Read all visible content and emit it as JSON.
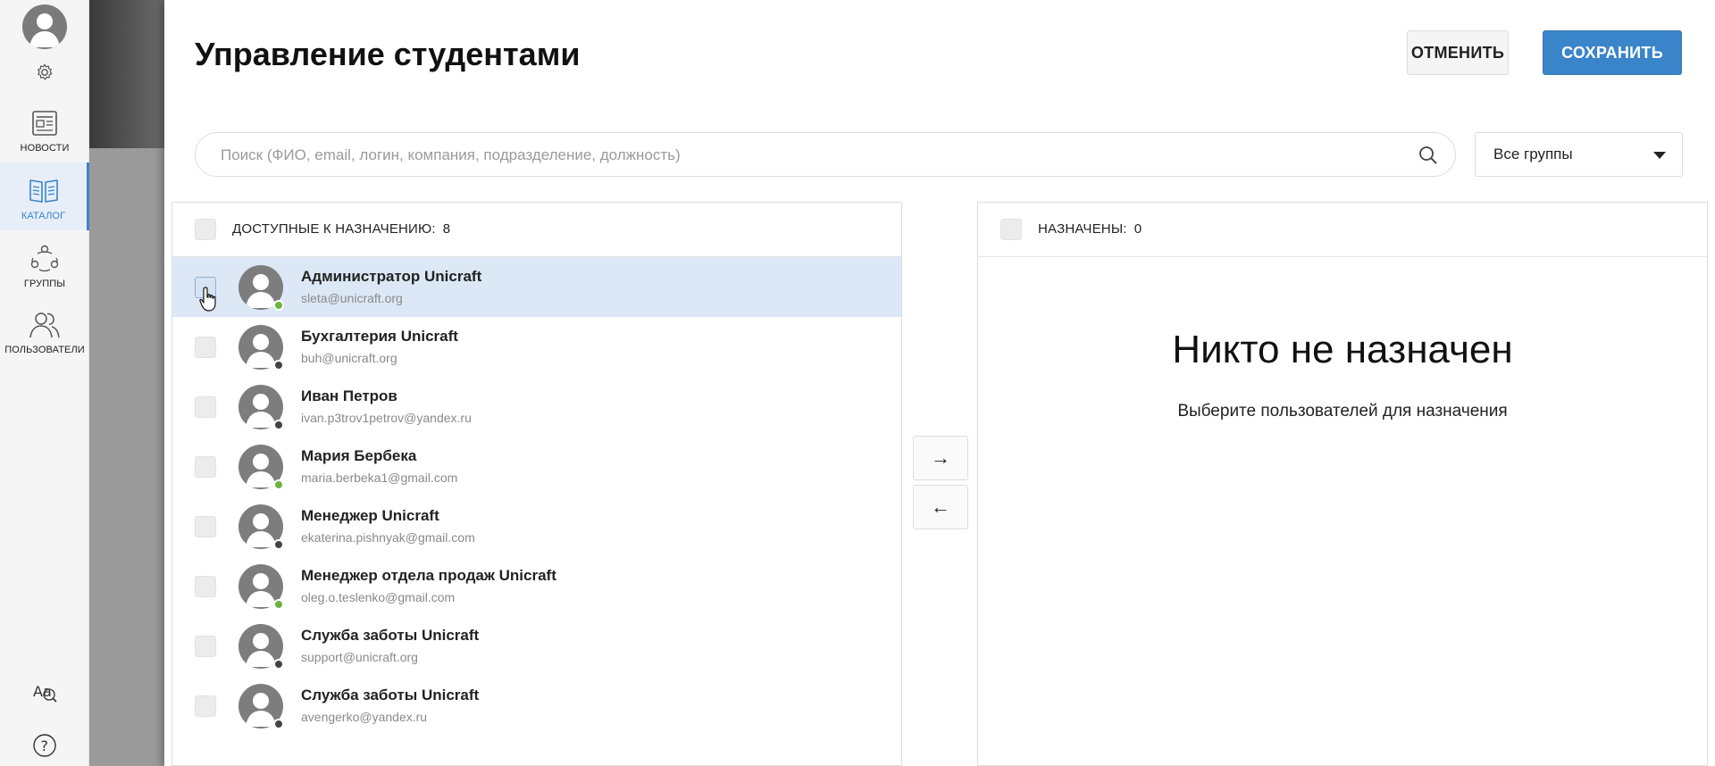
{
  "nav": {
    "items": [
      {
        "label": "НОВОСТИ",
        "icon": "newspaper-icon"
      },
      {
        "label": "КАТАЛОГ",
        "icon": "book-icon"
      },
      {
        "label": "ГРУППЫ",
        "icon": "groups-icon"
      },
      {
        "label": "ПОЛЬЗОВАТЕЛИ",
        "icon": "users-icon"
      }
    ],
    "active_index": 1
  },
  "header": {
    "title": "Управление студентами",
    "cancel_label": "ОТМЕНИТЬ",
    "save_label": "СОХРАНИТЬ"
  },
  "search": {
    "placeholder": "Поиск (ФИО, email, логин, компания, подразделение, должность)",
    "value": ""
  },
  "group_select": {
    "value": "Все группы"
  },
  "available": {
    "label": "ДОСТУПНЫЕ К НАЗНАЧЕНИЮ:",
    "count": "8",
    "users": [
      {
        "name": "Администратор Unicraft",
        "email": "sleta@unicraft.org",
        "status": "online"
      },
      {
        "name": "Бухгалтерия Unicraft",
        "email": "buh@unicraft.org",
        "status": "offline"
      },
      {
        "name": "Иван Петров",
        "email": "ivan.p3trov1petrov@yandex.ru",
        "status": "offline"
      },
      {
        "name": "Мария Бербека",
        "email": "maria.berbeka1@gmail.com",
        "status": "online"
      },
      {
        "name": "Менеджер Unicraft",
        "email": "ekaterina.pishnyak@gmail.com",
        "status": "offline"
      },
      {
        "name": "Менеджер отдела продаж Unicraft",
        "email": "oleg.o.teslenko@gmail.com",
        "status": "online"
      },
      {
        "name": "Служба заботы Unicraft",
        "email": "support@unicraft.org",
        "status": "offline"
      },
      {
        "name": "Служба заботы Unicraft",
        "email": "avengerko@yandex.ru",
        "status": "offline"
      }
    ]
  },
  "assigned": {
    "label": "НАЗНАЧЕНЫ:",
    "count": "0",
    "empty_title": "Никто не назначен",
    "empty_subtitle": "Выберите пользователей для назначения"
  },
  "transfer": {
    "right": "→",
    "left": "←"
  },
  "colors": {
    "accent": "#3a84c9",
    "online": "#6bb53b",
    "offline": "#444444",
    "selected_row": "#dce8f5"
  }
}
